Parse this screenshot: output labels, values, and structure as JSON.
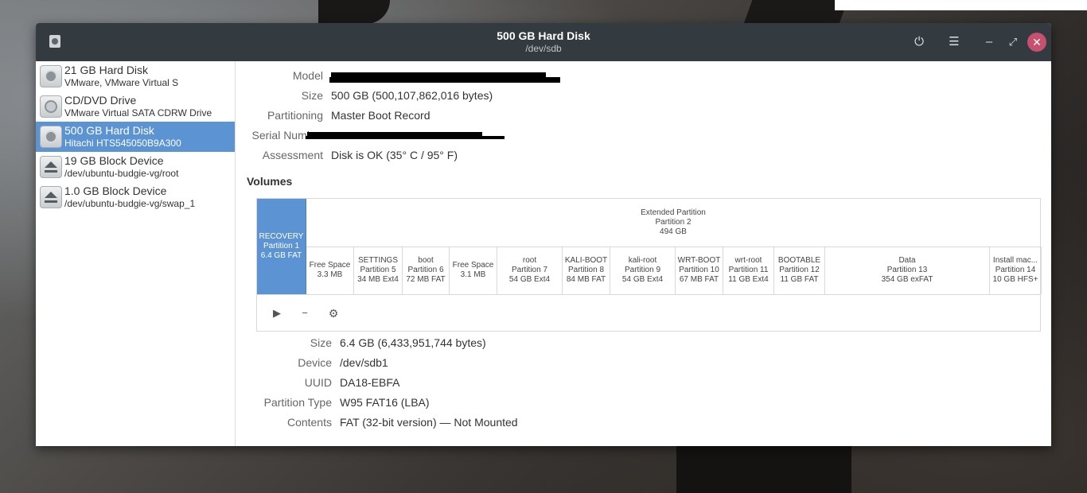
{
  "window": {
    "title": "500 GB Hard Disk",
    "subtitle": "/dev/sdb"
  },
  "header_buttons": {
    "power": "⏻",
    "menu": "☰",
    "minimize": "–",
    "maximize": "⤢",
    "close": "✕"
  },
  "sidebar": {
    "items": [
      {
        "name": "21 GB Hard Disk",
        "sub": "VMware, VMware Virtual S",
        "icon": "hard-disk-icon"
      },
      {
        "name": "CD/DVD Drive",
        "sub": "VMware Virtual SATA CDRW Drive",
        "icon": "optical-drive-icon"
      },
      {
        "name": "500 GB Hard Disk",
        "sub": "Hitachi HTS545050B9A300",
        "icon": "hard-disk-icon"
      },
      {
        "name": "19 GB Block Device",
        "sub": "/dev/ubuntu-budgie-vg/root",
        "icon": "eject-icon"
      },
      {
        "name": "1.0 GB Block Device",
        "sub": "/dev/ubuntu-budgie-vg/swap_1",
        "icon": "eject-icon"
      }
    ]
  },
  "disk": {
    "model_label": "Model",
    "size_label": "Size",
    "size_value": "500 GB (500,107,862,016 bytes)",
    "partitioning_label": "Partitioning",
    "partitioning_value": "Master Boot Record",
    "serial_label": "Serial Number",
    "assessment_label": "Assessment",
    "assessment_value": "Disk is OK (35° C / 95° F)"
  },
  "volumes": {
    "title": "Volumes",
    "extended": {
      "l1": "Extended Partition",
      "l2": "Partition 2",
      "l3": "494 GB"
    },
    "partitions": [
      {
        "l1": "RECOVERY",
        "l2": "Partition 1",
        "l3": "6.4 GB FAT"
      },
      {
        "l1": "Free Space",
        "l2": "3.3 MB",
        "l3": ""
      },
      {
        "l1": "SETTINGS",
        "l2": "Partition 5",
        "l3": "34 MB Ext4"
      },
      {
        "l1": "boot",
        "l2": "Partition 6",
        "l3": "72 MB FAT"
      },
      {
        "l1": "Free Space",
        "l2": "3.1 MB",
        "l3": ""
      },
      {
        "l1": "root",
        "l2": "Partition 7",
        "l3": "54 GB Ext4"
      },
      {
        "l1": "KALI-BOOT",
        "l2": "Partition 8",
        "l3": "84 MB FAT"
      },
      {
        "l1": "kali-root",
        "l2": "Partition 9",
        "l3": "54 GB Ext4"
      },
      {
        "l1": "WRT-BOOT",
        "l2": "Partition 10",
        "l3": "67 MB FAT"
      },
      {
        "l1": "wrt-root",
        "l2": "Partition 11",
        "l3": "11 GB Ext4"
      },
      {
        "l1": "BOOTABLE",
        "l2": "Partition 12",
        "l3": "11 GB FAT"
      },
      {
        "l1": "Data",
        "l2": "Partition 13",
        "l3": "354 GB exFAT"
      },
      {
        "l1": "Install mac...",
        "l2": "Partition 14",
        "l3": "10 GB HFS+"
      }
    ],
    "tools": {
      "mount": "▶",
      "delete": "−",
      "settings": "⚙"
    }
  },
  "partition": {
    "size_label": "Size",
    "size_value": "6.4 GB (6,433,951,744 bytes)",
    "device_label": "Device",
    "device_value": "/dev/sdb1",
    "uuid_label": "UUID",
    "uuid_value": "DA18-EBFA",
    "type_label": "Partition Type",
    "type_value": "W95 FAT16 (LBA)",
    "contents_label": "Contents",
    "contents_value": "FAT (32-bit version) — Not Mounted"
  }
}
